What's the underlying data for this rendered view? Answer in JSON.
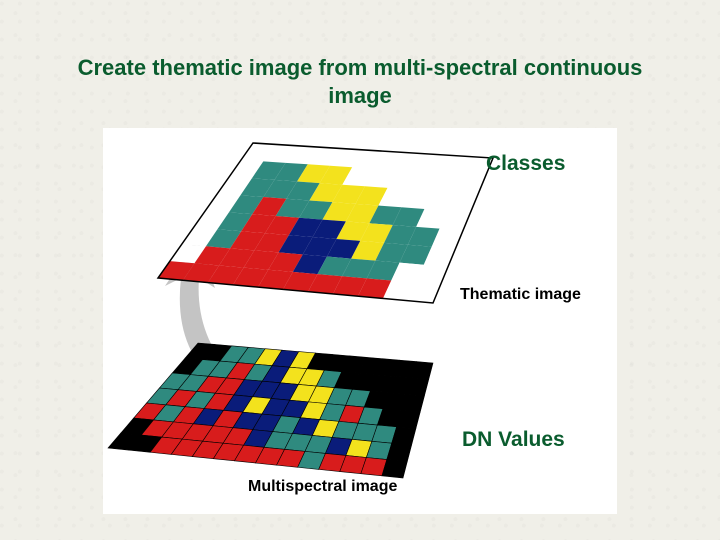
{
  "title_line1": "Create thematic image from multi-spectral continuous",
  "title_line2": "image",
  "labels": {
    "classes": "Classes",
    "dn_values": "DN Values",
    "thematic": "Thematic image",
    "multispectral": "Multispectral image"
  },
  "colors": {
    "teal": "#2f8a7f",
    "red": "#d81c1c",
    "yellow": "#f3e21d",
    "navy": "#0a1c7a",
    "white": "#ffffff",
    "black": "#000000",
    "arrow": "#c4c4c4",
    "title_green": "#0a5c2e"
  },
  "thematic_grid": {
    "cols": 11,
    "rows": 8,
    "cells": [
      [
        "white",
        "white",
        "white",
        "white",
        "white",
        "white",
        "white",
        "white",
        "white",
        "white",
        "white"
      ],
      [
        "white",
        "teal",
        "teal",
        "yellow",
        "yellow",
        "white",
        "white",
        "white",
        "white",
        "white",
        "white"
      ],
      [
        "white",
        "teal",
        "teal",
        "teal",
        "yellow",
        "yellow",
        "yellow",
        "white",
        "white",
        "white",
        "white"
      ],
      [
        "white",
        "teal",
        "red",
        "teal",
        "teal",
        "yellow",
        "yellow",
        "teal",
        "teal",
        "white",
        "white"
      ],
      [
        "white",
        "teal",
        "red",
        "red",
        "navy",
        "navy",
        "yellow",
        "yellow",
        "teal",
        "teal",
        "white"
      ],
      [
        "white",
        "teal",
        "red",
        "red",
        "navy",
        "navy",
        "navy",
        "yellow",
        "teal",
        "teal",
        "white"
      ],
      [
        "white",
        "red",
        "red",
        "red",
        "red",
        "navy",
        "teal",
        "teal",
        "teal",
        "white",
        "white"
      ],
      [
        "red",
        "red",
        "red",
        "red",
        "red",
        "red",
        "red",
        "red",
        "red",
        "white",
        "white"
      ]
    ]
  },
  "multispectral_grid": {
    "cols": 14,
    "rows": 7,
    "cells": [
      [
        "black",
        "black",
        "teal",
        "teal",
        "yellow",
        "navy",
        "yellow",
        "black",
        "black",
        "black",
        "black",
        "black",
        "black",
        "black"
      ],
      [
        "black",
        "teal",
        "teal",
        "red",
        "teal",
        "navy",
        "yellow",
        "yellow",
        "teal",
        "black",
        "black",
        "black",
        "black",
        "black"
      ],
      [
        "teal",
        "teal",
        "red",
        "red",
        "navy",
        "navy",
        "navy",
        "yellow",
        "yellow",
        "teal",
        "teal",
        "black",
        "black",
        "black"
      ],
      [
        "teal",
        "red",
        "teal",
        "red",
        "navy",
        "yellow",
        "navy",
        "navy",
        "yellow",
        "teal",
        "red",
        "teal",
        "black",
        "black"
      ],
      [
        "red",
        "teal",
        "red",
        "navy",
        "red",
        "navy",
        "navy",
        "teal",
        "navy",
        "yellow",
        "teal",
        "teal",
        "teal",
        "black"
      ],
      [
        "black",
        "red",
        "red",
        "red",
        "red",
        "red",
        "navy",
        "teal",
        "teal",
        "teal",
        "navy",
        "yellow",
        "teal",
        "black"
      ],
      [
        "black",
        "black",
        "red",
        "red",
        "red",
        "red",
        "red",
        "red",
        "red",
        "teal",
        "red",
        "red",
        "red",
        "black"
      ]
    ]
  }
}
